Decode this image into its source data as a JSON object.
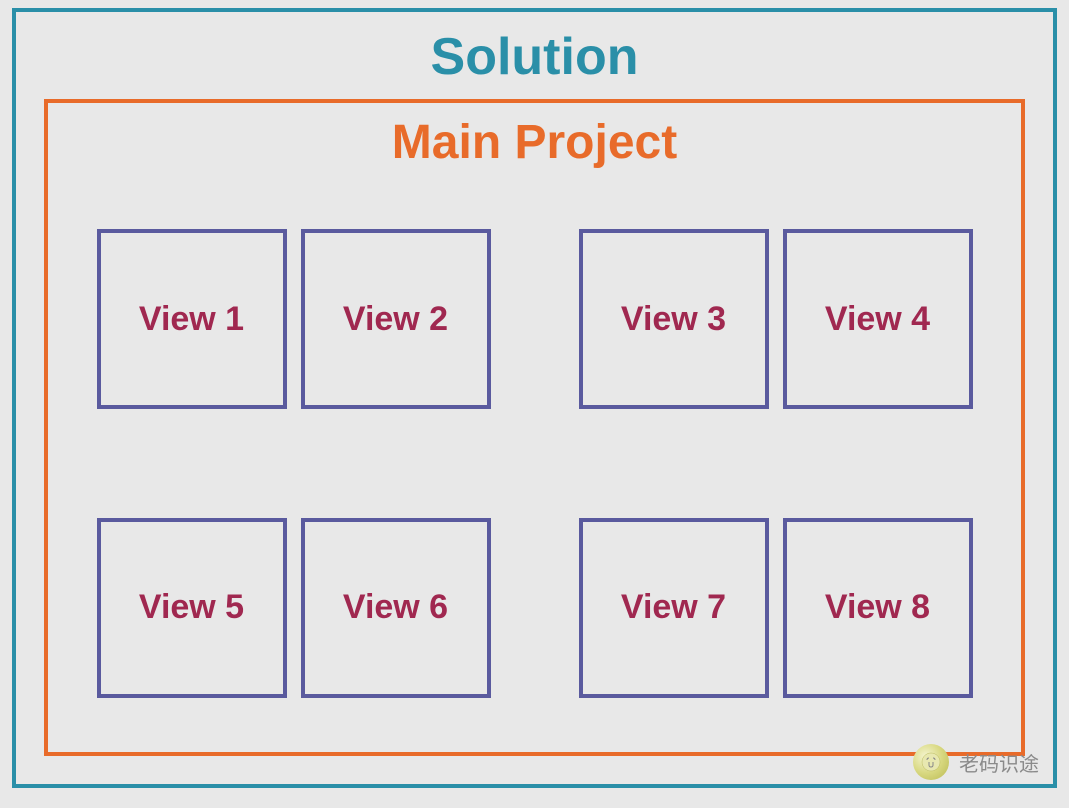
{
  "solution": {
    "title": "Solution",
    "title_color": "#2a8fa8",
    "border_color": "#2a8fa8"
  },
  "project": {
    "title": "Main Project",
    "title_color": "#e86b2a",
    "border_color": "#e86b2a"
  },
  "views": {
    "border_color": "#5a5a9e",
    "label_color": "#a02850",
    "rows": [
      {
        "groups": [
          {
            "items": [
              "View 1",
              "View 2"
            ]
          },
          {
            "items": [
              "View 3",
              "View 4"
            ]
          }
        ]
      },
      {
        "groups": [
          {
            "items": [
              "View 5",
              "View 6"
            ]
          },
          {
            "items": [
              "View 7",
              "View 8"
            ]
          }
        ]
      }
    ]
  },
  "watermark": {
    "text": "老码识途"
  }
}
